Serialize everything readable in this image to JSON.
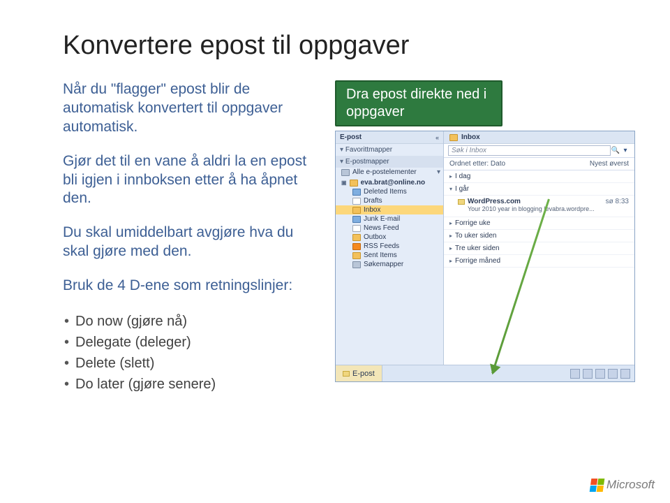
{
  "title": "Konvertere epost til oppgaver",
  "paragraphs": {
    "p1": "Når du \"flagger\" epost blir de automatisk konvertert til oppgaver automatisk.",
    "p2": "Gjør det til en vane å aldri la en epost bli igjen i innboksen etter å ha åpnet den.",
    "p3": "Du skal umiddelbart avgjøre hva du skal gjøre med den.",
    "p4": "Bruk de 4 D-ene som retningslinjer:"
  },
  "bullets": {
    "b1": "Do now (gjøre nå)",
    "b2": "Delegate (deleger)",
    "b3": "Delete (slett)",
    "b4": "Do later (gjøre senere)"
  },
  "callout": "Dra epost direkte ned i oppgaver",
  "outlook": {
    "epost_header": "E-post",
    "fav_label": "Favorittmapper",
    "mailboxes_label": "E-postmapper",
    "all_items": "Alle e-postelementer",
    "folders": {
      "account": "eva.brat@online.no",
      "deleted": "Deleted Items",
      "drafts": "Drafts",
      "inbox": "Inbox",
      "junk": "Junk E-mail",
      "news": "News Feed",
      "outbox": "Outbox",
      "rss": "RSS Feeds",
      "sent": "Sent Items",
      "search": "Søkemapper"
    },
    "right": {
      "inbox_title": "Inbox",
      "search_placeholder": "Søk i Inbox",
      "sort_left": "Ordnet etter: Dato",
      "sort_right": "Nyest øverst",
      "groups": {
        "today": "I dag",
        "yesterday": "I går",
        "lastweek2": "To uker siden",
        "lastweek3": "Tre uker siden",
        "lastmonth": "Forrige måned",
        "older": "Forrige uke"
      },
      "msg": {
        "from": "WordPress.com",
        "time": "sø 8:33",
        "subj": "Your 2010 year in blogging |evabra.wordpre..."
      }
    },
    "footer_tab": "E-post"
  },
  "brand": "Microsoft"
}
